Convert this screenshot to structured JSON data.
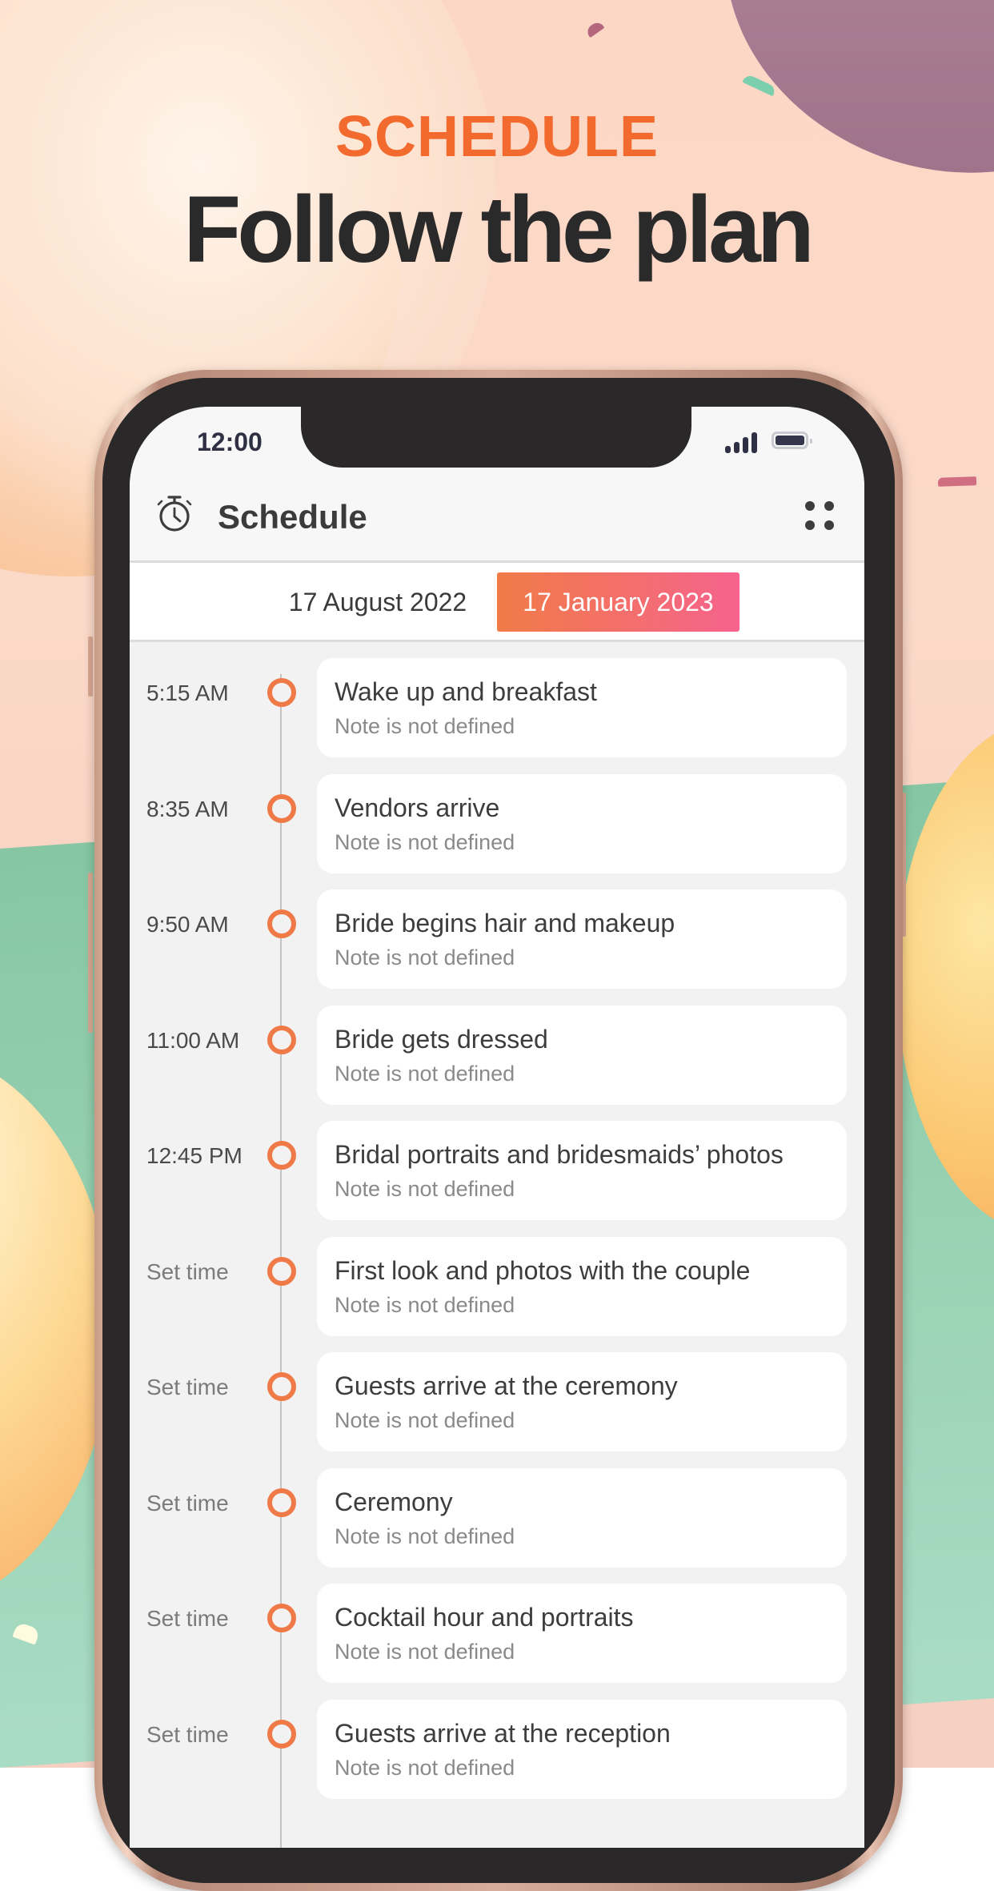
{
  "hero": {
    "kicker": "SCHEDULE",
    "title": "Follow the plan"
  },
  "colors": {
    "accent": "#F26A2E",
    "chip_gradient_start": "#F27B47",
    "chip_gradient_end": "#F6638E",
    "timeline_dot": "#F07A47"
  },
  "status_bar": {
    "time": "12:00",
    "icons": [
      "signal-icon",
      "battery-icon"
    ]
  },
  "app_header": {
    "icon": "stopwatch-icon",
    "title": "Schedule",
    "menu_icon": "grid-menu-icon"
  },
  "date_tabs": [
    {
      "label": "17 August 2022",
      "active": false
    },
    {
      "label": "17 January 2023",
      "active": true
    }
  ],
  "schedule": [
    {
      "time": "5:15 AM",
      "title": "Wake up and breakfast",
      "note": "Note is not defined"
    },
    {
      "time": "8:35 AM",
      "title": "Vendors arrive",
      "note": "Note is not defined"
    },
    {
      "time": "9:50 AM",
      "title": "Bride begins hair and makeup",
      "note": "Note is not defined"
    },
    {
      "time": "11:00 AM",
      "title": "Bride gets dressed",
      "note": "Note is not defined"
    },
    {
      "time": "12:45 PM",
      "title": "Bridal portraits and bridesmaids’ photos",
      "note": "Note is not defined"
    },
    {
      "time": "Set time",
      "title": "First look and photos with the couple",
      "note": "Note is not defined"
    },
    {
      "time": "Set time",
      "title": "Guests arrive at the ceremony",
      "note": "Note is not defined"
    },
    {
      "time": "Set time",
      "title": "Ceremony",
      "note": "Note is not defined"
    },
    {
      "time": "Set time",
      "title": "Cocktail hour and portraits",
      "note": "Note is not defined"
    },
    {
      "time": "Set time",
      "title": "Guests arrive at the reception",
      "note": "Note is not defined"
    }
  ]
}
